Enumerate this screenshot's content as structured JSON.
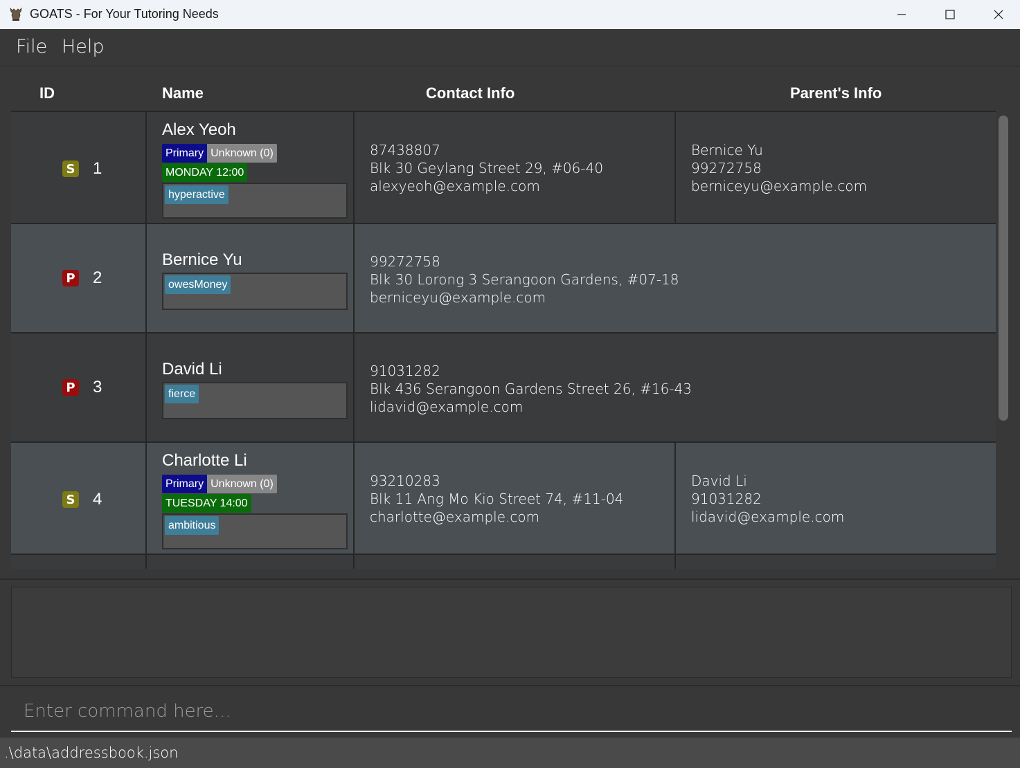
{
  "window": {
    "title": "GOATS - For Your Tutoring Needs"
  },
  "menu": {
    "file": "File",
    "help": "Help"
  },
  "table": {
    "headers": {
      "id": "ID",
      "name": "Name",
      "contact": "Contact Info",
      "parent": "Parent's Info"
    },
    "rows": [
      {
        "role": "S",
        "id": "1",
        "name": "Alex Yeoh",
        "level": "Primary",
        "grade": "Unknown (0)",
        "session": "MONDAY 12:00",
        "tags": [
          "hyperactive"
        ],
        "phone": "87438807",
        "address": "Blk 30 Geylang Street 29, #06-40",
        "email": "alexyeoh@example.com",
        "parent": {
          "name": "Bernice Yu",
          "phone": "99272758",
          "email": "berniceyu@example.com"
        }
      },
      {
        "role": "P",
        "id": "2",
        "name": "Bernice Yu",
        "tags": [
          "owesMoney"
        ],
        "phone": "99272758",
        "address": "Blk 30 Lorong 3 Serangoon Gardens, #07-18",
        "email": "berniceyu@example.com"
      },
      {
        "role": "P",
        "id": "3",
        "name": "David Li",
        "tags": [
          "fierce"
        ],
        "phone": "91031282",
        "address": "Blk 436 Serangoon Gardens Street 26, #16-43",
        "email": "lidavid@example.com"
      },
      {
        "role": "S",
        "id": "4",
        "name": "Charlotte Li",
        "level": "Primary",
        "grade": "Unknown (0)",
        "session": "TUESDAY 14:00",
        "tags": [
          "ambitious"
        ],
        "phone": "93210283",
        "address": "Blk 11 Ang Mo Kio Street 74, #11-04",
        "email": "charlotte@example.com",
        "parent": {
          "name": "David Li",
          "phone": "91031282",
          "email": "lidavid@example.com"
        }
      }
    ]
  },
  "command": {
    "placeholder": "Enter command here..."
  },
  "status": {
    "path": ".\\data\\addressbook.json"
  },
  "colors": {
    "role_student": "#7d7b13",
    "role_parent": "#9b0c0c",
    "level_tag": "#0d0d8c",
    "grade_tag": "#878787",
    "session_tag": "#0a6b0a",
    "trait_tag": "#3f7e99"
  }
}
